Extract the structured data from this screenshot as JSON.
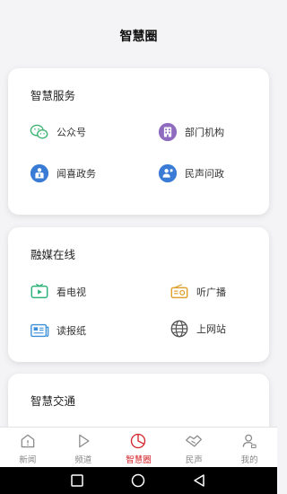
{
  "header": {
    "title": "智慧圈"
  },
  "sections": [
    {
      "title": "智慧服务",
      "items": [
        {
          "label": "公众号",
          "icon": "wechat-icon"
        },
        {
          "label": "部门机构",
          "icon": "building-icon"
        },
        {
          "label": "闻喜政务",
          "icon": "government-icon"
        },
        {
          "label": "民声问政",
          "icon": "citizen-voice-icon"
        }
      ]
    },
    {
      "title": "融媒在线",
      "items": [
        {
          "label": "看电视",
          "icon": "tv-icon"
        },
        {
          "label": "听广播",
          "icon": "radio-icon"
        },
        {
          "label": "读报纸",
          "icon": "newspaper-icon"
        },
        {
          "label": "上网站",
          "icon": "globe-icon"
        }
      ]
    },
    {
      "title": "智慧交通",
      "items": []
    }
  ],
  "tabs": [
    {
      "label": "新闻",
      "icon": "news-icon",
      "active": false
    },
    {
      "label": "频道",
      "icon": "play-icon",
      "active": false
    },
    {
      "label": "智慧圈",
      "icon": "pie-chart-icon",
      "active": true
    },
    {
      "label": "民声",
      "icon": "handshake-icon",
      "active": false
    },
    {
      "label": "我的",
      "icon": "profile-icon",
      "active": false
    }
  ],
  "colors": {
    "accent": "#d4242a",
    "wechat": "#3cb371",
    "purple": "#8e6bbf",
    "blue": "#3a7bd5",
    "tv_green": "#2fb27a",
    "radio_orange": "#e0a030",
    "paper_blue": "#3a8fd8"
  }
}
